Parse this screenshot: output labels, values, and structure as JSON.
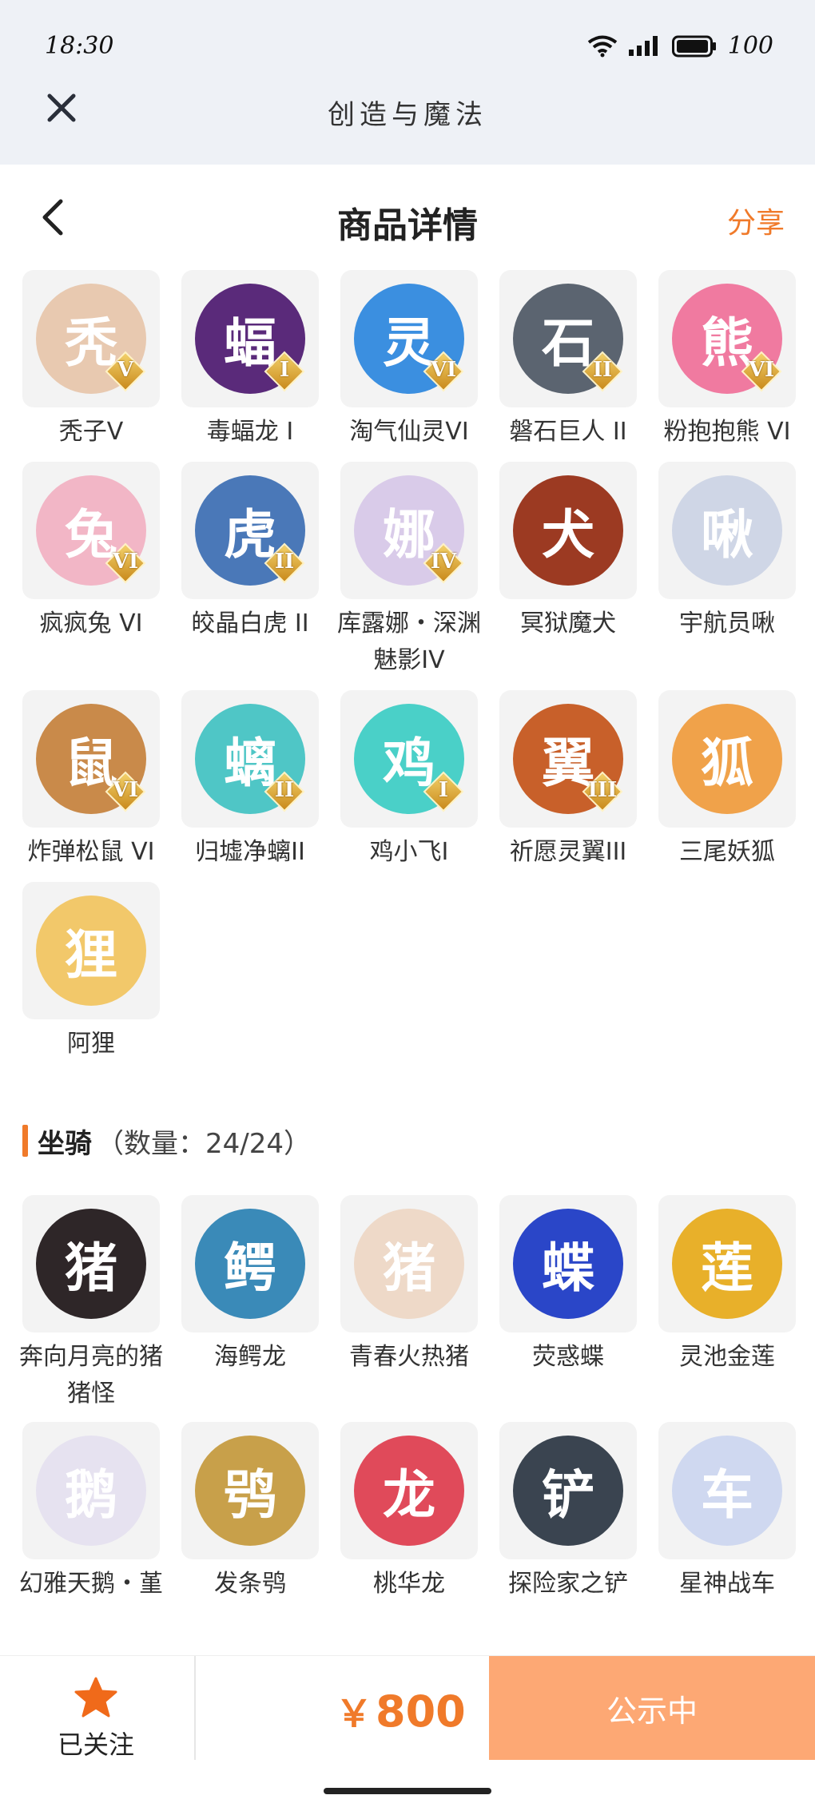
{
  "status": {
    "time": "18:30",
    "battery": "100"
  },
  "app": {
    "title": "创造与魔法"
  },
  "header": {
    "title": "商品详情",
    "share": "分享"
  },
  "pets": [
    {
      "name": "秃子V",
      "tier": "V",
      "color": "#e8c9b0",
      "glyph": "秃"
    },
    {
      "name": "毒蝠龙 I",
      "tier": "I",
      "color": "#5a2a7a",
      "glyph": "蝠"
    },
    {
      "name": "淘气仙灵VI",
      "tier": "VI",
      "color": "#3b8fe0",
      "glyph": "灵"
    },
    {
      "name": "磐石巨人 II",
      "tier": "II",
      "color": "#5b6470",
      "glyph": "石"
    },
    {
      "name": "粉抱抱熊 VI",
      "tier": "VI",
      "color": "#f07aa0",
      "glyph": "熊"
    },
    {
      "name": "疯疯兔 VI",
      "tier": "VI",
      "color": "#f2b6c6",
      "glyph": "兔"
    },
    {
      "name": "皎晶白虎 II",
      "tier": "II",
      "color": "#4a78b8",
      "glyph": "虎"
    },
    {
      "name": "库露娜・深渊魅影IV",
      "tier": "IV",
      "color": "#d9cbe9",
      "glyph": "娜"
    },
    {
      "name": "冥狱魔犬",
      "tier": "",
      "color": "#9c3a22",
      "glyph": "犬"
    },
    {
      "name": "宇航员啾",
      "tier": "",
      "color": "#cfd6e6",
      "glyph": "啾"
    },
    {
      "name": "炸弹松鼠 VI",
      "tier": "VI",
      "color": "#c98a4a",
      "glyph": "鼠"
    },
    {
      "name": "归墟净螭II",
      "tier": "II",
      "color": "#4fc6c6",
      "glyph": "螭"
    },
    {
      "name": "鸡小飞I",
      "tier": "I",
      "color": "#4ad0c8",
      "glyph": "鸡"
    },
    {
      "name": "祈愿灵翼III",
      "tier": "III",
      "color": "#c8602a",
      "glyph": "翼"
    },
    {
      "name": "三尾妖狐",
      "tier": "",
      "color": "#f0a24a",
      "glyph": "狐"
    },
    {
      "name": "阿狸",
      "tier": "",
      "color": "#f2c86a",
      "glyph": "狸"
    }
  ],
  "mounts_section": {
    "title": "坐骑",
    "count": "（数量：24/24）"
  },
  "mounts": [
    {
      "name": "奔向月亮的猪猪怪",
      "color": "#2e2628",
      "glyph": "猪"
    },
    {
      "name": "海鳄龙",
      "color": "#3a8ab8",
      "glyph": "鳄"
    },
    {
      "name": "青春火热猪",
      "color": "#eed9c8",
      "glyph": "猪"
    },
    {
      "name": "荧惑蝶",
      "color": "#2a46c8",
      "glyph": "蝶"
    },
    {
      "name": "灵池金莲",
      "color": "#e8b02a",
      "glyph": "莲"
    },
    {
      "name": "幻雅天鹅・堇",
      "color": "#e6e2f0",
      "glyph": "鹅"
    },
    {
      "name": "发条鸮",
      "color": "#c8a04a",
      "glyph": "鸮"
    },
    {
      "name": "桃华龙",
      "color": "#e04a5a",
      "glyph": "龙"
    },
    {
      "name": "探险家之铲",
      "color": "#3a4450",
      "glyph": "铲"
    },
    {
      "name": "星神战车",
      "color": "#cfd8f0",
      "glyph": "车"
    }
  ],
  "bottom": {
    "follow_label": "已关注",
    "price_symbol": "￥",
    "price": "800",
    "cta": "公示中"
  },
  "colors": {
    "accent": "#f07a2a",
    "cta": "#fda874"
  }
}
